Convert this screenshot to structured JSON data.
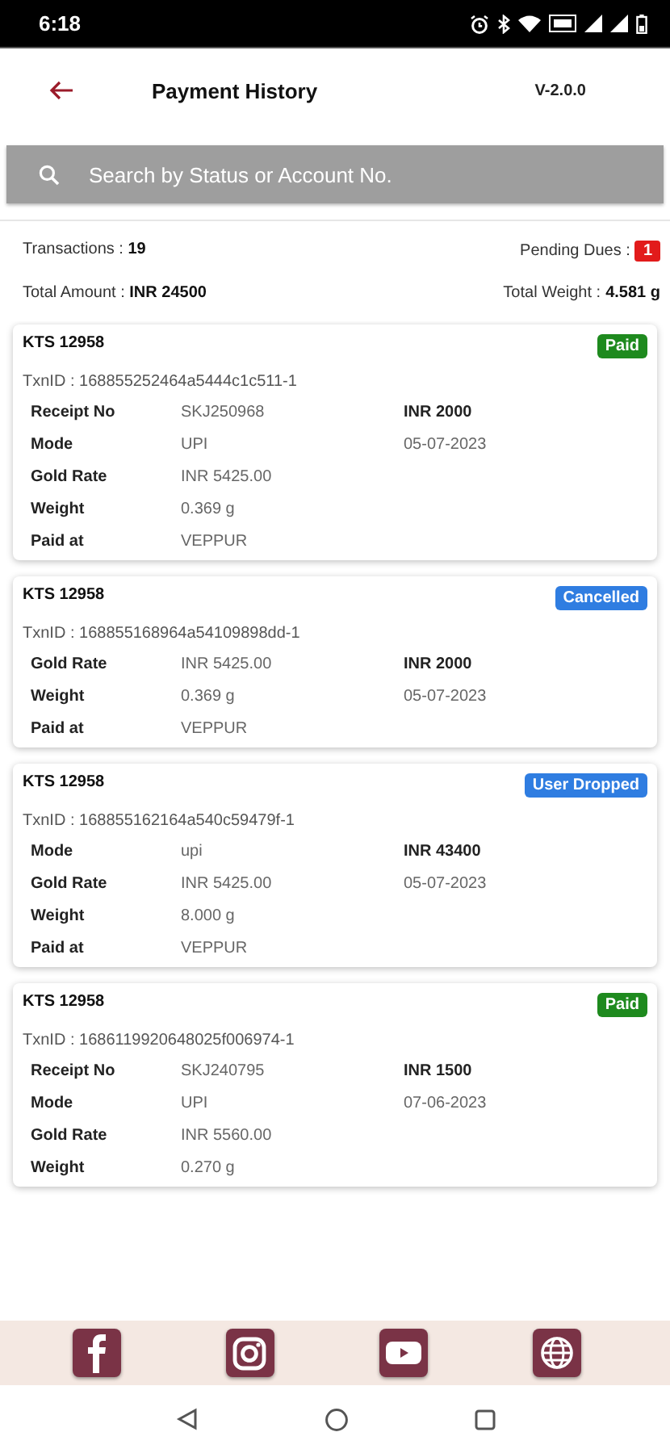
{
  "status_bar": {
    "time": "6:18"
  },
  "header": {
    "title": "Payment History",
    "version": "V-2.0.0"
  },
  "search": {
    "placeholder": "Search by Status or Account No."
  },
  "summary": {
    "transactions_label": "Transactions : ",
    "transactions": "19",
    "pending_label": "Pending Dues : ",
    "pending": "1",
    "amount_label": "Total Amount : ",
    "amount": "INR 24500",
    "weight_label": "Total Weight : ",
    "weight": "4.581 g"
  },
  "transactions": [
    {
      "account": "KTS 12958",
      "status": {
        "text": "Paid",
        "kind": "paid"
      },
      "txn_id": "TxnID : 168855252464a5444c1c511-1",
      "rows": [
        {
          "label": "Receipt No",
          "value": "SKJ250968",
          "amount": "INR  2000"
        },
        {
          "label": "Mode",
          "value": "UPI",
          "date": "05-07-2023"
        },
        {
          "label": "Gold Rate",
          "value": "INR 5425.00"
        },
        {
          "label": "Weight",
          "value": "0.369 g"
        },
        {
          "label": "Paid at",
          "value": "VEPPUR"
        }
      ]
    },
    {
      "account": "KTS 12958",
      "status": {
        "text": "Cancelled",
        "kind": "cancelled"
      },
      "txn_id": "TxnID : 168855168964a54109898dd-1",
      "rows": [
        {
          "label": "Gold Rate",
          "value": "INR 5425.00",
          "amount": "INR  2000"
        },
        {
          "label": "Weight",
          "value": "0.369 g",
          "date": "05-07-2023"
        },
        {
          "label": "Paid at",
          "value": "VEPPUR"
        }
      ]
    },
    {
      "account": "KTS 12958",
      "status": {
        "text": "User Dropped",
        "kind": "dropped"
      },
      "txn_id": "TxnID : 168855162164a540c59479f-1",
      "rows": [
        {
          "label": "Mode",
          "value": "upi",
          "amount": "INR  43400"
        },
        {
          "label": "Gold Rate",
          "value": "INR 5425.00",
          "date": "05-07-2023"
        },
        {
          "label": "Weight",
          "value": "8.000 g"
        },
        {
          "label": "Paid at",
          "value": "VEPPUR"
        }
      ]
    },
    {
      "account": "KTS 12958",
      "status": {
        "text": "Paid",
        "kind": "paid"
      },
      "txn_id": "TxnID : 1686119920648025f006974-1",
      "rows": [
        {
          "label": "Receipt No",
          "value": "SKJ240795",
          "amount": "INR  1500"
        },
        {
          "label": "Mode",
          "value": "UPI",
          "date": "07-06-2023"
        },
        {
          "label": "Gold Rate",
          "value": "INR 5560.00"
        },
        {
          "label": "Weight",
          "value": "0.270 g"
        }
      ]
    }
  ],
  "footer": {
    "links": [
      {
        "kind": "facebook"
      },
      {
        "kind": "instagram"
      },
      {
        "kind": "youtube"
      },
      {
        "kind": "web"
      }
    ]
  }
}
